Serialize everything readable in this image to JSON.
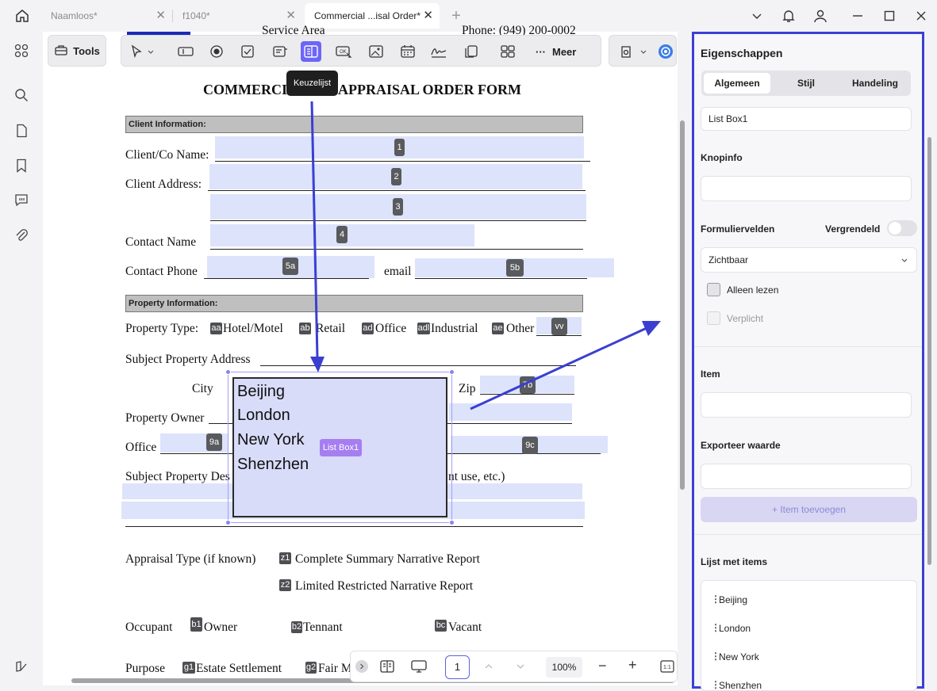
{
  "tabs": [
    {
      "label": "Naamloos*"
    },
    {
      "label": "f1040*"
    },
    {
      "label": "Commercial ...isal Order*"
    }
  ],
  "toolbar": {
    "tools_label": "Tools",
    "more_label": "Meer",
    "tooltip": "Keuzelijst"
  },
  "form": {
    "header_fragment": "Service Area",
    "phone_fragment": "Phone:  (949) 200-0002",
    "title_left": "COMMERCI",
    "title_right": "APPRAISAL ORDER FORM",
    "client_section": "Client Information:",
    "client_name_label": "Client/Co Name:",
    "client_address_label": "Client Address:",
    "contact_name_label": "Contact Name",
    "contact_phone_label": "Contact Phone",
    "email_label": "email",
    "property_section": "Property Information:",
    "property_type_label": "Property Type:",
    "hotel_label": "Hotel/Motel",
    "retail_label": "Retail",
    "office_type_label": "Office",
    "industrial_label": "Industrial",
    "other_label": "Other",
    "subject_address_label": "Subject Property Address",
    "city_label": "City",
    "zip_label": "Zip",
    "owner_label": "Property Owner",
    "office_label": "Office",
    "subject_desc_label": "Subject Property Des",
    "subject_desc_tail": "nt use, etc.)",
    "appraisal_type_label": "Appraisal Type (if known)",
    "complete_summary": "Complete Summary Narrative Report",
    "limited_restricted": "Limited Restricted Narrative Report",
    "occupant_label": "Occupant",
    "owner_opt": "Owner",
    "tennant_opt": "Tennant",
    "vacant_opt": "Vacant",
    "purpose_label": "Purpose",
    "estate_opt": "Estate Settlement",
    "fair_opt": "Fair M"
  },
  "badges": {
    "b1": "1",
    "b2": "2",
    "b3": "3",
    "b4": "4",
    "b5a": "5a",
    "b5b": "5b",
    "vv": "vv",
    "b7b": "7b",
    "b9a": "9a",
    "b9c": "9c",
    "aa": "aa",
    "ab": "ab",
    "ad": "ad",
    "adl": "adl",
    "ae": "ae",
    "z1": "z1",
    "z2": "z2",
    "bb1": "b1",
    "bb2": "b2",
    "bc": "bc",
    "g1": "g1",
    "g2": "g2"
  },
  "listbox": {
    "items": [
      "Beijing",
      "London",
      "New York",
      "Shenzhen"
    ],
    "tag": "List Box1"
  },
  "bottombar": {
    "page": "1",
    "zoom": "100%"
  },
  "panel": {
    "title": "Eigenschappen",
    "tabs": [
      "Algemeen",
      "Stijl",
      "Handeling"
    ],
    "name_value": "List Box1",
    "tooltip_label": "Knopinfo",
    "form_fields_label": "Formuliervelden",
    "locked_label": "Vergrendeld",
    "visibility_value": "Zichtbaar",
    "readonly_label": "Alleen lezen",
    "required_label": "Verplicht",
    "item_label": "Item",
    "export_label": "Exporteer waarde",
    "add_item": "+ Item toevoegen",
    "list_label": "Lijst met items",
    "list_items": [
      "Beijing",
      "London",
      "New York",
      "Shenzhen"
    ]
  },
  "colors": {
    "accent": "#3b40d6",
    "active_tool": "#6b66f7",
    "field_fill": "#dde3fb",
    "tag": "#a67ef0",
    "arrow": "#3a3fd2"
  }
}
